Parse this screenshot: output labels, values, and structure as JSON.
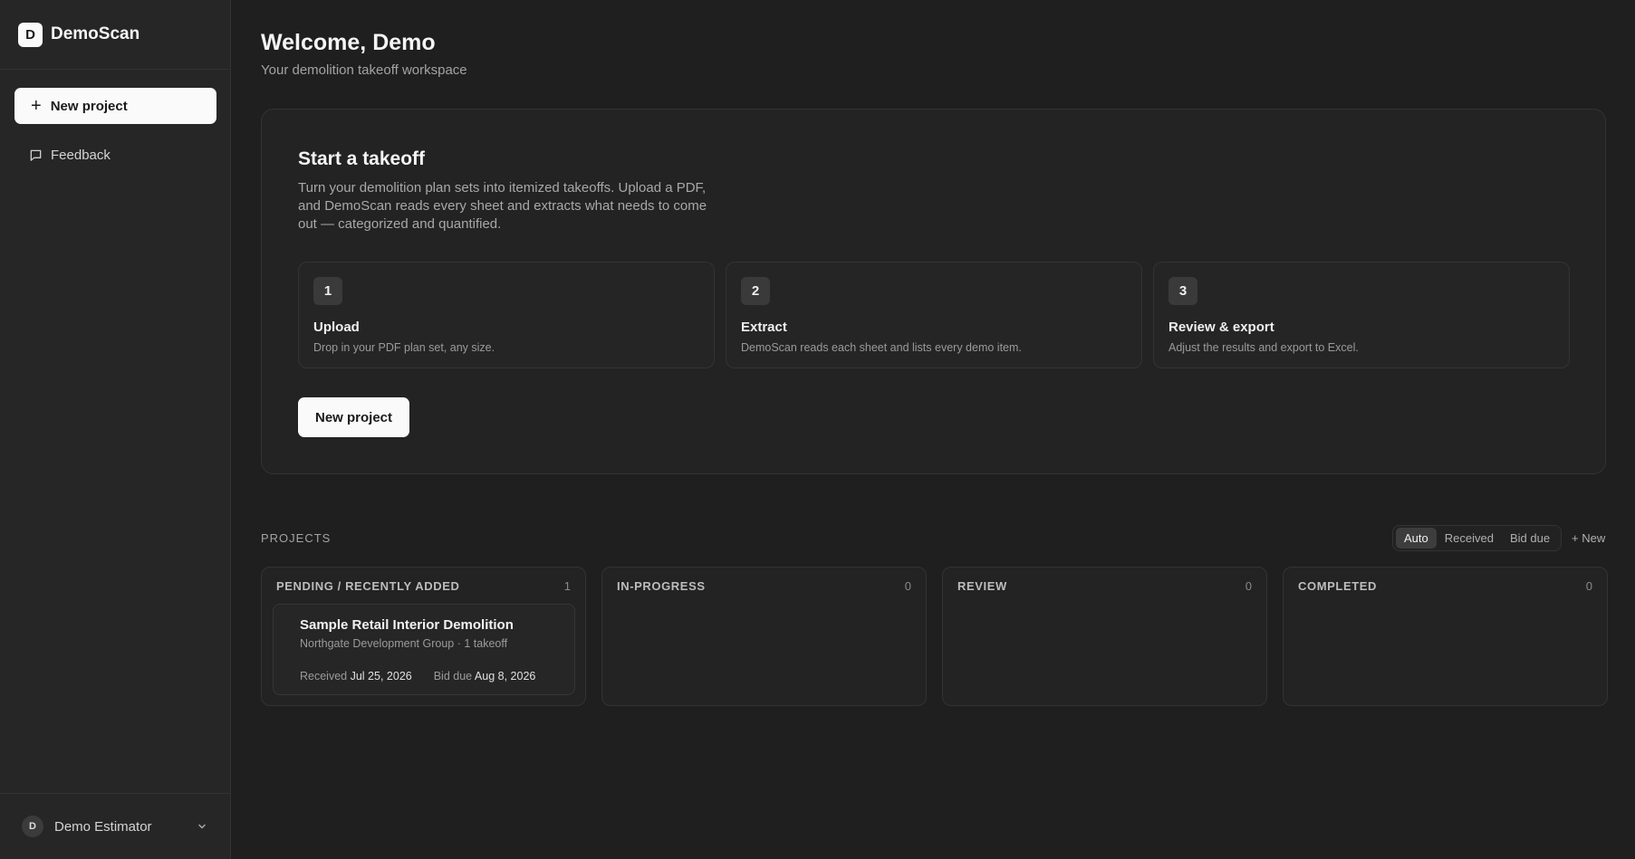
{
  "sidebar": {
    "brand": {
      "logo_letter": "D",
      "name": "DemoScan"
    },
    "new_project_label": "New project",
    "feedback_label": "Feedback",
    "user": {
      "initial": "D",
      "name": "Demo Estimator"
    }
  },
  "header": {
    "title": "Welcome, Demo",
    "subtitle": "Your demolition takeoff workspace"
  },
  "start": {
    "title": "Start a takeoff",
    "description": "Turn your demolition plan sets into itemized takeoffs. Upload a PDF, and DemoScan reads every sheet and extracts what needs to come out — categorized and quantified.",
    "steps": [
      {
        "number": "1",
        "title": "Upload",
        "description": "Drop in your PDF plan set, any size."
      },
      {
        "number": "2",
        "title": "Extract",
        "description": "DemoScan reads each sheet and lists every demo item."
      },
      {
        "number": "3",
        "title": "Review & export",
        "description": "Adjust the results and export to Excel."
      }
    ],
    "button_label": "New project"
  },
  "projects": {
    "header": "PROJECTS",
    "sort_options": [
      "Auto",
      "Received",
      "Bid due"
    ],
    "sort_selected": "Auto",
    "new_label": "+ New",
    "columns": [
      {
        "title": "PENDING / RECENTLY ADDED",
        "count": "1"
      },
      {
        "title": "IN-PROGRESS",
        "count": "0"
      },
      {
        "title": "REVIEW",
        "count": "0"
      },
      {
        "title": "COMPLETED",
        "count": "0"
      }
    ],
    "cards": [
      {
        "title": "Sample Retail Interior Demolition",
        "subtitle": "Northgate Development Group · 1 takeoff",
        "received_label": "Received",
        "received": "Jul 25, 2026",
        "bid_due_label": "Bid due",
        "bid_due": "Aug 8, 2026"
      }
    ]
  }
}
